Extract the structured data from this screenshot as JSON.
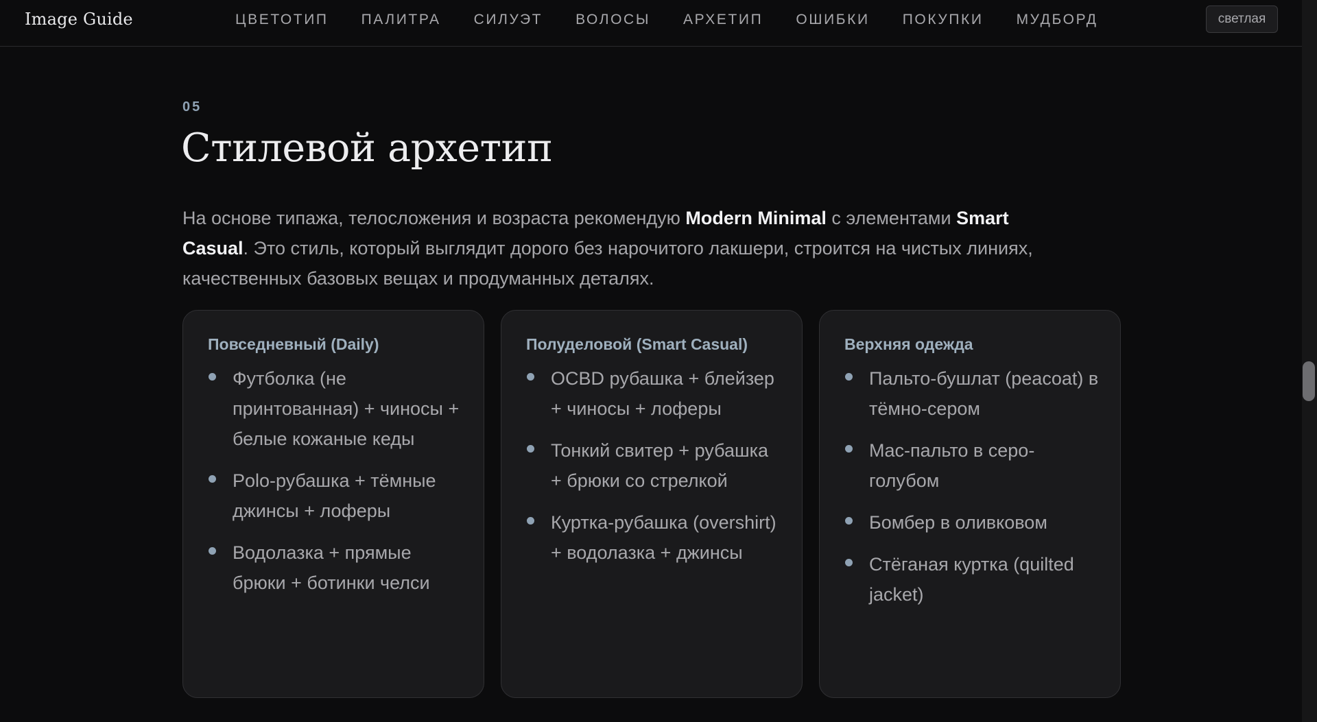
{
  "header": {
    "logo": "Image Guide",
    "nav": [
      "ЦВЕТОТИП",
      "ПАЛИТРА",
      "СИЛУЭТ",
      "ВОЛОСЫ",
      "АРХЕТИП",
      "ОШИБКИ",
      "ПОКУПКИ",
      "МУДБОРД"
    ],
    "theme_button": "светлая"
  },
  "section": {
    "number": "05",
    "title": "Стилевой архетип",
    "intro": {
      "part1": "На основе типажа, телосложения и возраста рекомендую ",
      "bold1": "Modern Minimal",
      "part2": " с элементами ",
      "bold2": "Smart Casual",
      "part3": ". Это стиль, который выглядит дорого без нарочитого лакшери, строится на чистых линиях, качественных базовых вещах и продуманных деталях."
    }
  },
  "cards": [
    {
      "title": "Повседневный (Daily)",
      "items": [
        "Футболка (не принтованная) + чиносы + белые кожаные кеды",
        "Polo-рубашка + тёмные джинсы + лоферы",
        "Водолазка + прямые брюки + ботинки челси"
      ]
    },
    {
      "title": "Полуделовой (Smart Casual)",
      "items": [
        "OCBD рубашка + блейзер + чиносы + лоферы",
        "Тонкий свитер + рубашка + брюки со стрелкой",
        "Куртка-рубашка (overshirt) + водолазка + джинсы"
      ]
    },
    {
      "title": "Верхняя одежда",
      "items": [
        "Пальто-бушлат (peacoat) в тёмно-сером",
        "Mac-пальто в серо-голубом",
        "Бомбер в оливковом",
        "Стёганая куртка (quilted jacket)"
      ]
    }
  ]
}
